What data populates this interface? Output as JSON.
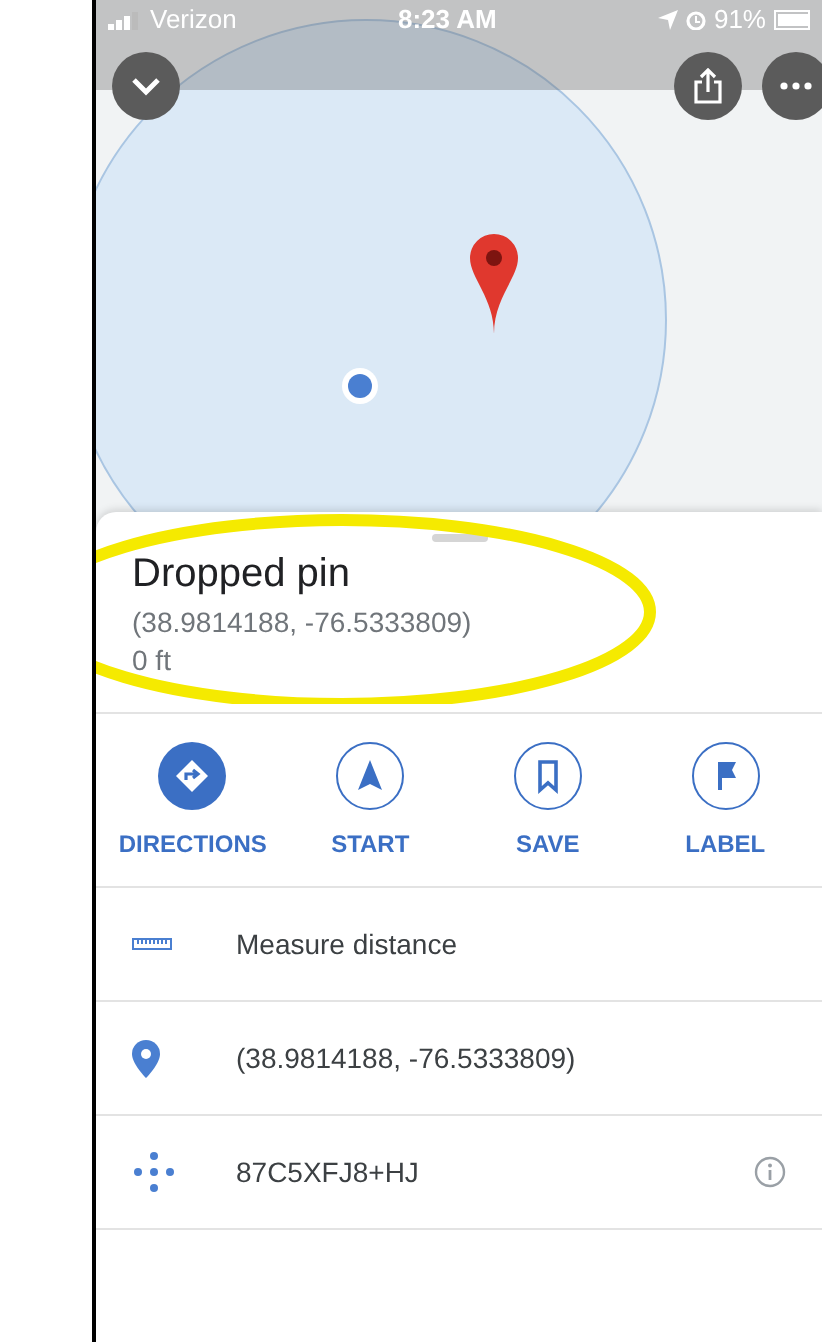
{
  "status_bar": {
    "carrier": "Verizon",
    "time": "8:23 AM",
    "battery": "91%"
  },
  "place": {
    "title": "Dropped pin",
    "coordinates": "(38.9814188, -76.5333809)",
    "distance": "0 ft"
  },
  "actions": [
    {
      "label": "DIRECTIONS",
      "kind": "directions",
      "filled": true
    },
    {
      "label": "START",
      "kind": "start",
      "filled": false
    },
    {
      "label": "SAVE",
      "kind": "save",
      "filled": false
    },
    {
      "label": "LABEL",
      "kind": "label",
      "filled": false
    }
  ],
  "details": [
    {
      "kind": "ruler",
      "text": "Measure distance",
      "info": false
    },
    {
      "kind": "pin",
      "text": "(38.9814188, -76.5333809)",
      "info": false
    },
    {
      "kind": "pluscode",
      "text": "87C5XFJ8+HJ",
      "info": true
    }
  ]
}
